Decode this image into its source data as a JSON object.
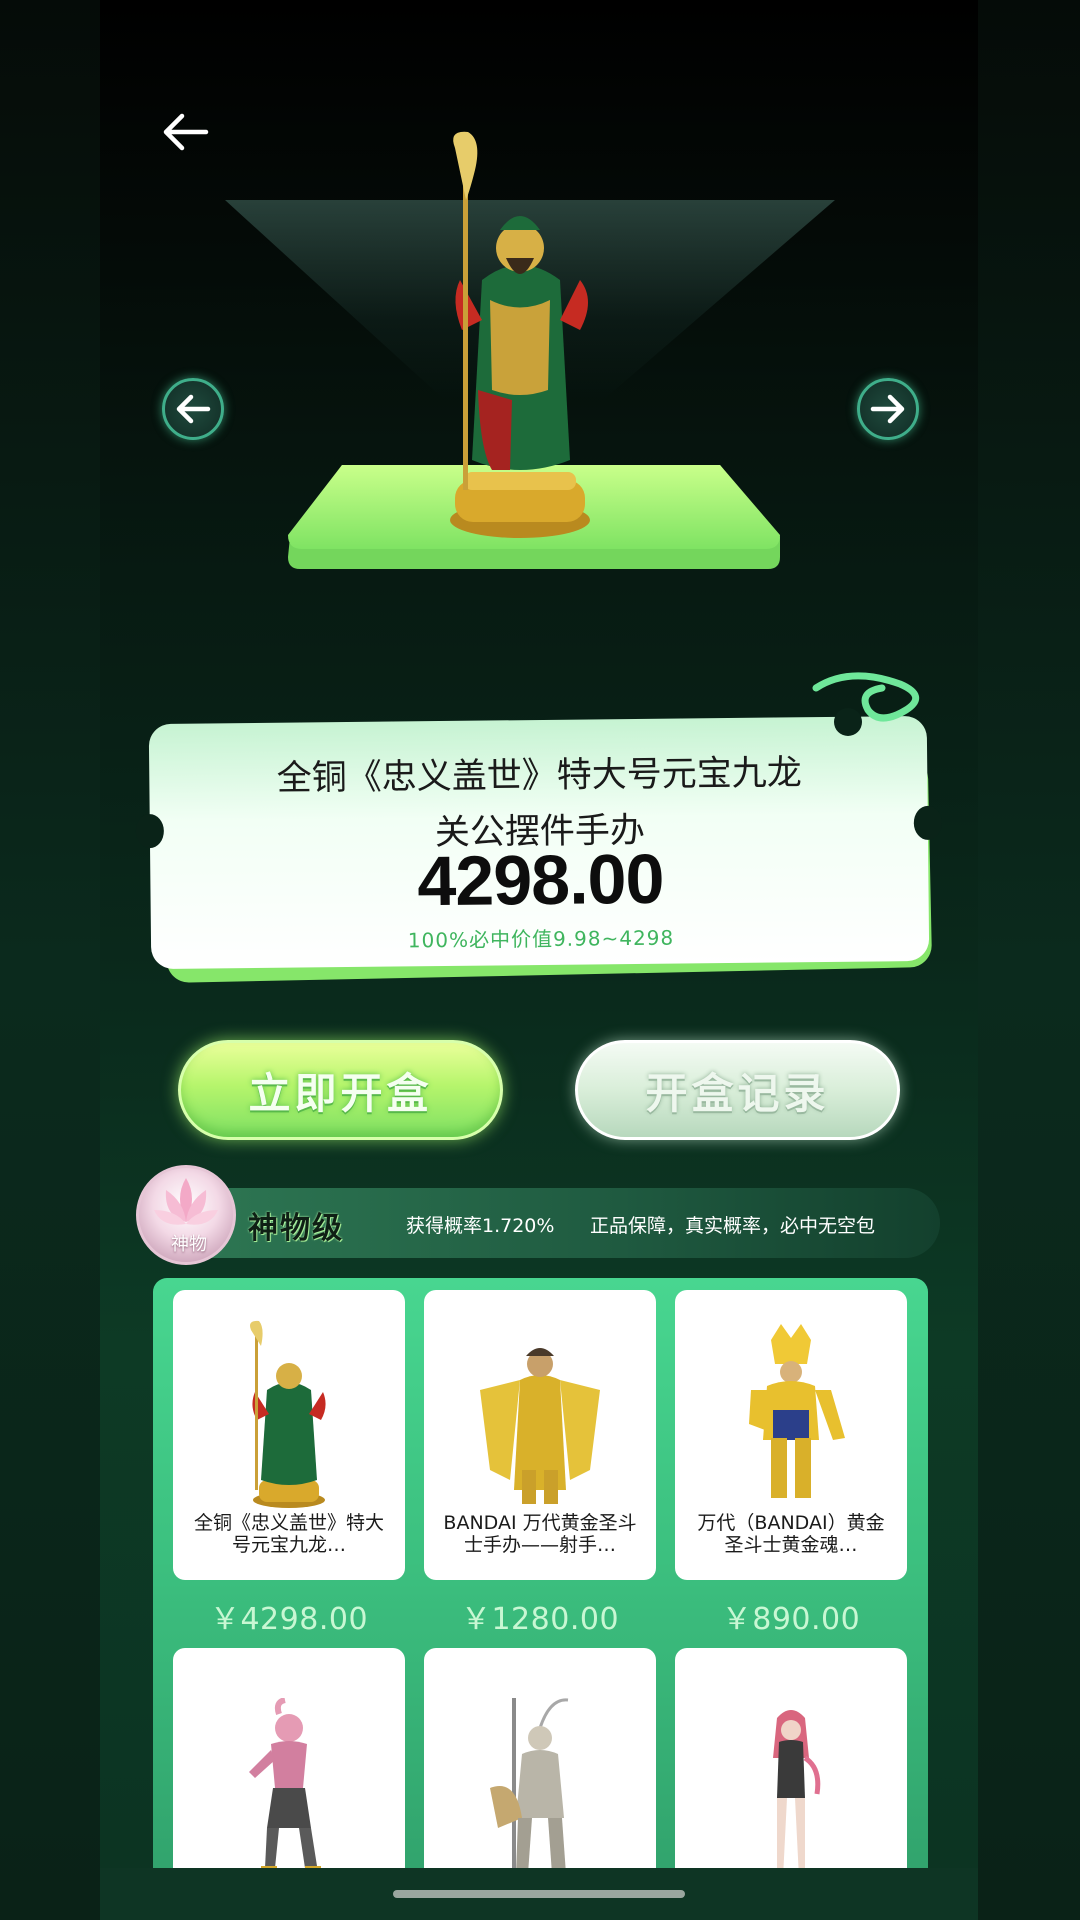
{
  "product": {
    "title_line1": "全铜《忠义盖世》特大号元宝九龙",
    "title_line2": "关公摆件手办",
    "price": "4298.00",
    "value_range": "100%必中价值9.98~4298"
  },
  "actions": {
    "open_box": "立即开盒",
    "open_records": "开盒记录"
  },
  "tier": {
    "badge_label": "神物",
    "name": "神物级",
    "rate": "获得概率1.720%",
    "guarantee": "正品保障，真实概率，必中无空包"
  },
  "items": [
    {
      "name": "全铜《忠义盖世》特大号元宝九龙…",
      "price": "￥4298.00"
    },
    {
      "name": "BANDAI 万代黄金圣斗士手办——射手…",
      "price": "￥1280.00"
    },
    {
      "name": "万代（BANDAI）黄金圣斗士黄金魂…",
      "price": "￥890.00"
    },
    {
      "name": "",
      "price": ""
    },
    {
      "name": "",
      "price": ""
    },
    {
      "name": "",
      "price": ""
    }
  ],
  "icons": {
    "back": "back-arrow-icon",
    "prev": "arrow-left-icon",
    "next": "arrow-right-icon"
  },
  "colors": {
    "accent_green": "#86e66a",
    "value_text": "#3fb55e",
    "price_text": "#c8f7d3"
  }
}
